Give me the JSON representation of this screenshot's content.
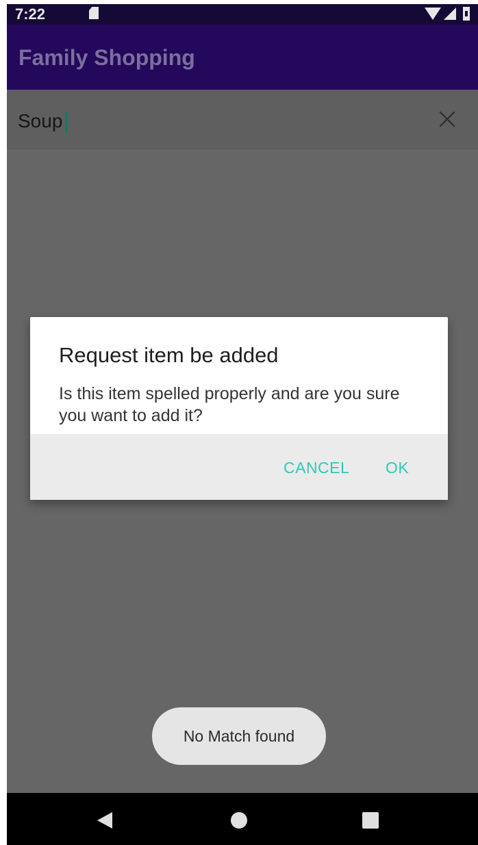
{
  "status_bar": {
    "time": "7:22",
    "icons": [
      "sd-card-icon",
      "wifi-icon",
      "signal-icon",
      "battery-icon"
    ]
  },
  "app_bar": {
    "title": "Family Shopping"
  },
  "search": {
    "value": "Soup",
    "clear_icon": "close-icon"
  },
  "dialog": {
    "title": "Request item be added",
    "message": "Is this item spelled properly and are you sure you want to add it?",
    "cancel_label": "CANCEL",
    "ok_label": "OK"
  },
  "toast": {
    "text": "No Match found"
  },
  "nav_bar": {
    "icons": [
      "back-icon",
      "home-icon",
      "recents-icon"
    ]
  },
  "colors": {
    "app_bar": "#24085c",
    "status_bar": "#150a35",
    "accent": "#2ec9b5",
    "scrim": "#666666"
  }
}
